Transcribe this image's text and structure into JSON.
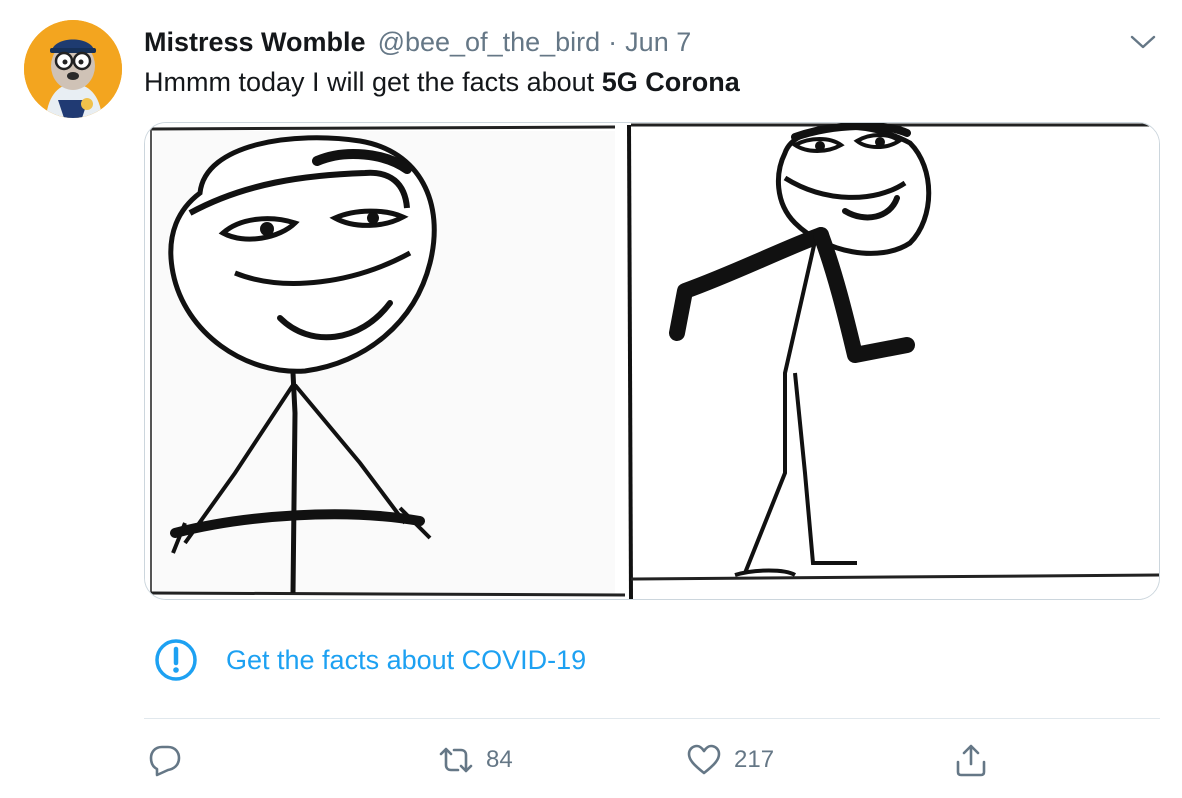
{
  "tweet": {
    "author_name": "Mistress Womble",
    "author_handle": "@bee_of_the_bird",
    "separator": "·",
    "date": "Jun 7",
    "text_plain": "Hmmm today I will get the facts about ",
    "text_bold": "5G Corona"
  },
  "notice": {
    "label": "Get the facts about COVID-19"
  },
  "actions": {
    "retweet_count": "84",
    "like_count": "217"
  },
  "colors": {
    "link": "#1da1f2",
    "secondary_text": "#657786",
    "divider": "#e1e8ed"
  },
  "icons": {
    "caret": "chevron-down-icon",
    "notice": "exclamation-circle-icon",
    "reply": "reply-icon",
    "retweet": "retweet-icon",
    "like": "heart-icon",
    "share": "share-icon"
  }
}
